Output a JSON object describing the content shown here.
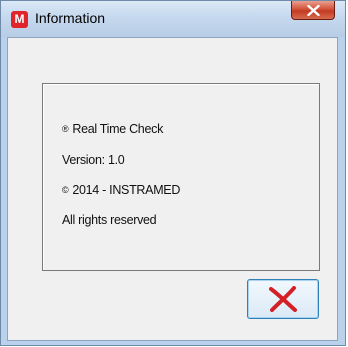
{
  "window": {
    "title": "Information",
    "app_icon_letter": "M"
  },
  "info": {
    "product": "Real Time Check",
    "product_mark": "®",
    "version": "Version: 1.0",
    "copyright": "2014 - INSTRAMED",
    "copyright_mark": "©",
    "rights": "All rights reserved"
  },
  "colors": {
    "close_button": "#c8452c",
    "ok_x": "#d41f26",
    "app_icon": "#e0242b"
  },
  "icons": {
    "close": "close-icon",
    "ok": "x-mark-icon"
  }
}
